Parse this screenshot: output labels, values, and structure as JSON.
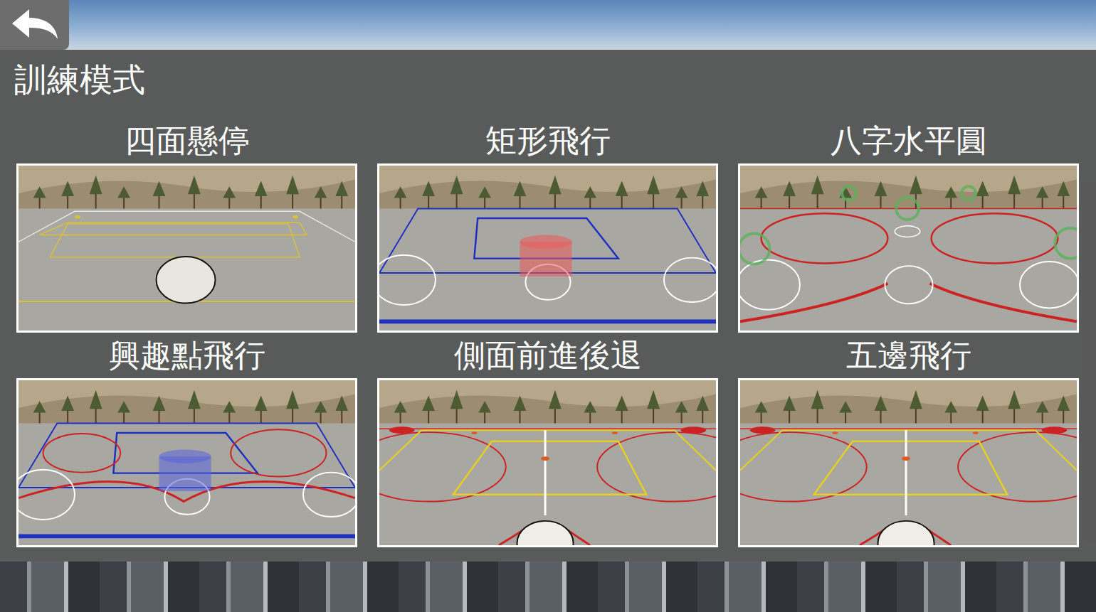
{
  "screen": {
    "title": "訓練模式"
  },
  "modes": [
    {
      "title": "四面懸停",
      "kind": "hover"
    },
    {
      "title": "矩形飛行",
      "kind": "rectangle"
    },
    {
      "title": "八字水平圓",
      "kind": "figure-eight"
    },
    {
      "title": "興趣點飛行",
      "kind": "poi"
    },
    {
      "title": "側面前進後退",
      "kind": "side"
    },
    {
      "title": "五邊飛行",
      "kind": "pentagon"
    }
  ]
}
